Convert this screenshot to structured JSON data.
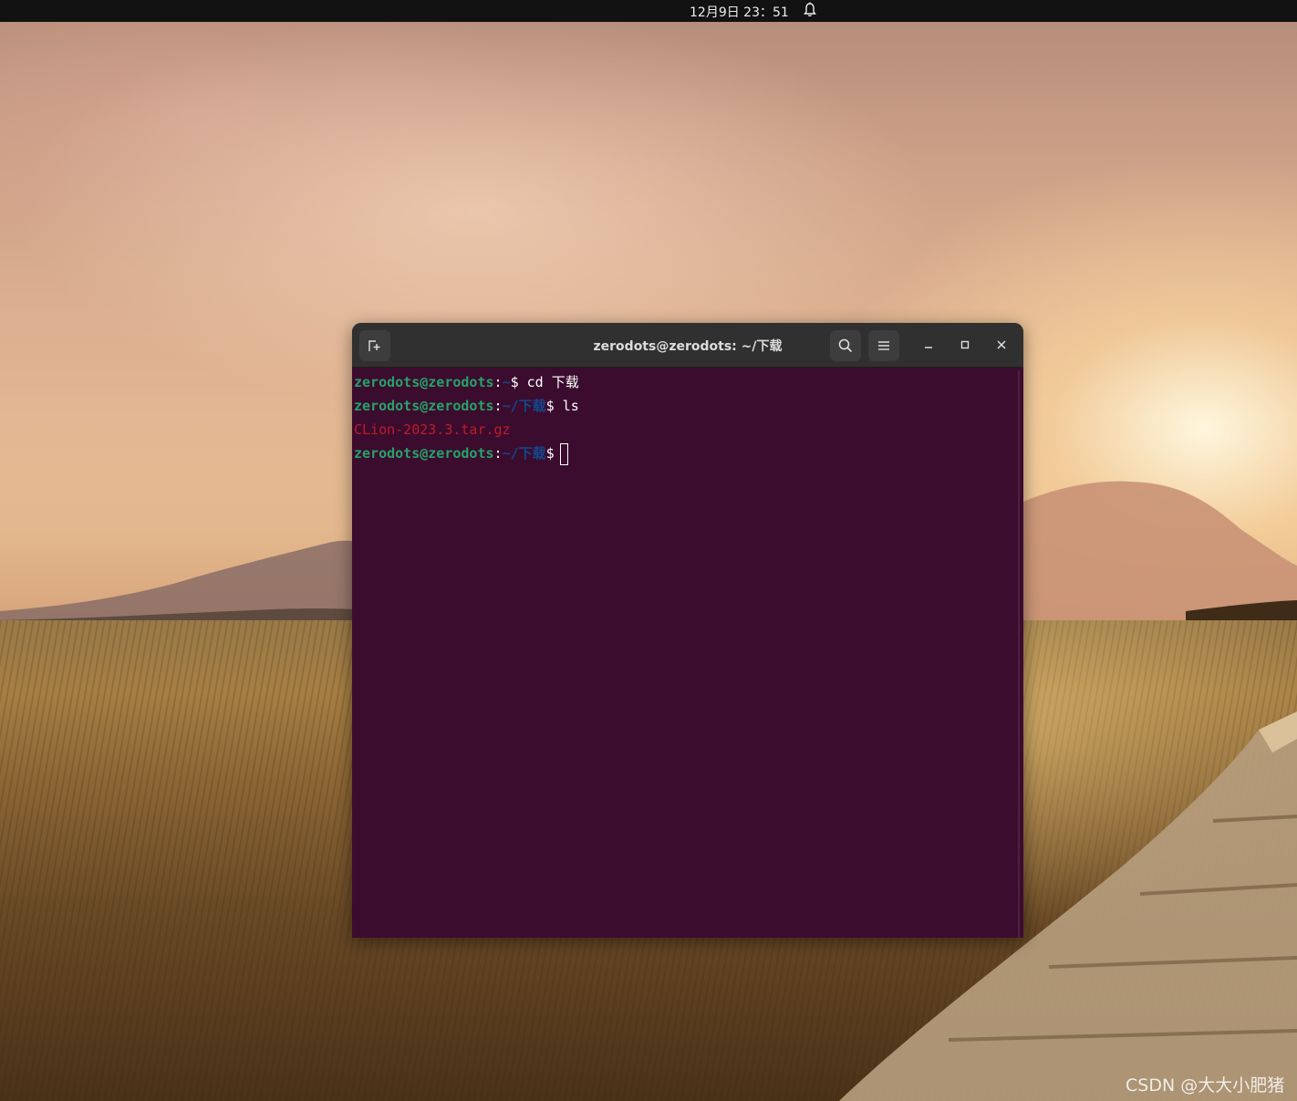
{
  "topbar": {
    "clock": "12月9日  23：51",
    "notification_icon": "bell-icon"
  },
  "terminal_window": {
    "title": "zerodots@zerodots: ~/下载",
    "buttons": {
      "new_tab_icon": "new-tab-icon",
      "search_icon": "search-icon",
      "menu_icon": "hamburger-menu-icon",
      "minimize_icon": "minimize-icon",
      "maximize_icon": "maximize-icon",
      "close_icon": "close-icon"
    },
    "lines": [
      {
        "user": "zerodots@zerodots",
        "sep": ":",
        "path": "~",
        "rest": "$ cd 下载"
      },
      {
        "user": "zerodots@zerodots",
        "sep": ":",
        "path": "~/下载",
        "rest": "$ ls"
      },
      {
        "output": "CLion-2023.3.tar.gz"
      },
      {
        "user": "zerodots@zerodots",
        "sep": ":",
        "path": "~/下载",
        "rest": "$"
      }
    ],
    "colors": {
      "background": "#3b0c2e",
      "user": "#26a269",
      "path": "#12488b",
      "archive_file": "#c01c28"
    }
  },
  "watermark": "CSDN @大大小肥猪"
}
